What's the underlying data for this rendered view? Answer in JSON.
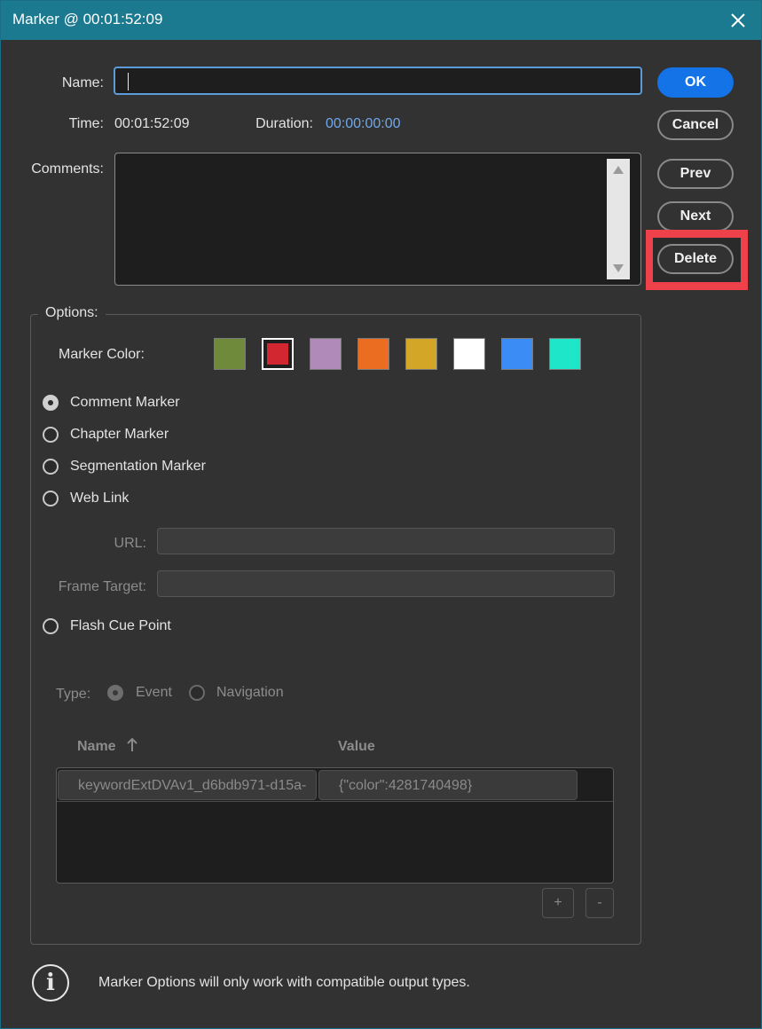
{
  "window": {
    "title": "Marker @ 00:01:52:09"
  },
  "fields": {
    "name_label": "Name:",
    "name_value": "",
    "time_label": "Time:",
    "time_value": "00:01:52:09",
    "duration_label": "Duration:",
    "duration_value": "00:00:00:00",
    "comments_label": "Comments:",
    "comments_value": ""
  },
  "buttons": {
    "ok": "OK",
    "cancel": "Cancel",
    "prev": "Prev",
    "next": "Next",
    "delete": "Delete"
  },
  "options": {
    "legend": "Options:",
    "marker_color_label": "Marker Color:",
    "colors": [
      "#6f8a3a",
      "#d22631",
      "#b08ab8",
      "#ea6d22",
      "#d3a628",
      "#ffffff",
      "#3c8cf6",
      "#1ee6c8"
    ],
    "selected_color_index": 1,
    "marker_types": [
      {
        "label": "Comment Marker",
        "checked": true
      },
      {
        "label": "Chapter Marker",
        "checked": false
      },
      {
        "label": "Segmentation Marker",
        "checked": false
      },
      {
        "label": "Web Link",
        "checked": false
      }
    ],
    "url_label": "URL:",
    "url_value": "",
    "frame_target_label": "Frame Target:",
    "frame_target_value": "",
    "flash_cue_point_label": "Flash Cue Point",
    "type_label": "Type:",
    "type_options": [
      {
        "label": "Event",
        "checked": true
      },
      {
        "label": "Navigation",
        "checked": false
      }
    ],
    "table": {
      "col_name": "Name",
      "col_value": "Value",
      "rows": [
        {
          "name": "keywordExtDVAv1_d6bdb971-d15a-",
          "value": "{\"color\":4281740498}"
        }
      ],
      "add_label": "+",
      "remove_label": "-"
    }
  },
  "info": {
    "icon": "info-icon",
    "text": "Marker Options will only work with compatible output types."
  },
  "colors": {
    "titlebar": "#1b7a8f",
    "primary_button": "#1473e6",
    "highlight": "#ef4149",
    "duration_text": "#6fa8ea"
  }
}
